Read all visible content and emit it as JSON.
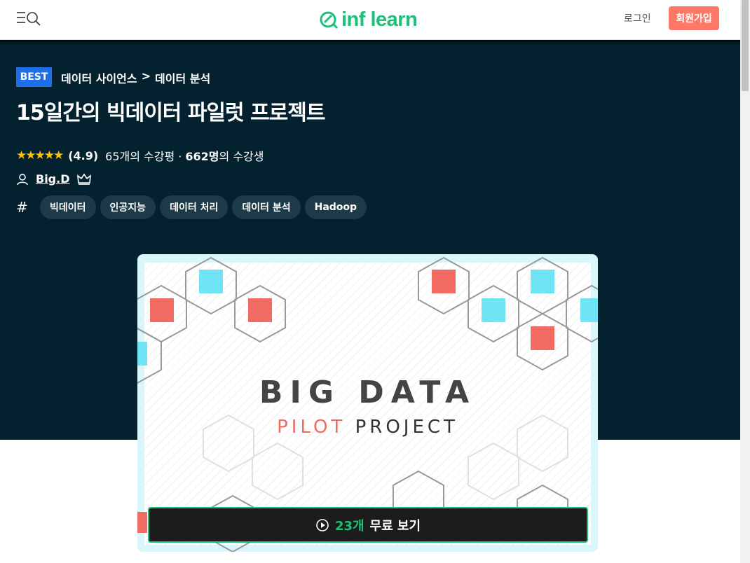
{
  "header": {
    "logo": "inf learn",
    "login_label": "로그인",
    "signup_label": "회원가입"
  },
  "course": {
    "badge": "BEST",
    "breadcrumb": [
      "데이터 사이언스",
      ">",
      "데이터 분석"
    ],
    "title": "15일간의 빅데이터 파일럿 프로젝트",
    "stars": "★★★★★",
    "rating": "(4.9)",
    "reviews": "65개의 수강평 ·",
    "students_count": "662명",
    "students_suffix": "의 수강생",
    "instructor": "Big.D",
    "tags": [
      "빅데이터",
      "인공지능",
      "데이터 처리",
      "데이터 분석",
      "Hadoop"
    ]
  },
  "thumbnail": {
    "title": "BIG DATA",
    "sub_red": "PILOT",
    "sub_dark": "PROJECT"
  },
  "preview_button": {
    "count": "23개",
    "label": "무료 보기"
  },
  "colors": {
    "brand": "#1dc078",
    "hero_bg": "#03212f",
    "signup_bg": "#ff7867",
    "badge_bg": "#1c6fe8",
    "star": "#fdc000",
    "hex_red": "#f26b62",
    "hex_cyan": "#6fe4f5"
  }
}
